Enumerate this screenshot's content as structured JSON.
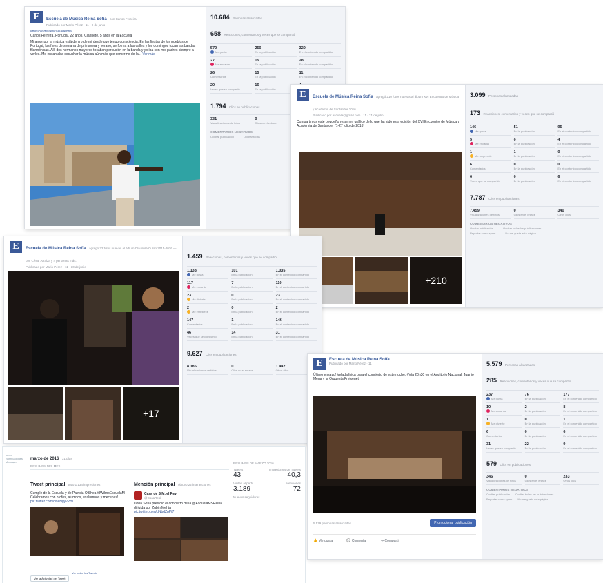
{
  "page_name": "Escuela de Música Reina Sofía",
  "logo_letter": "E",
  "card1": {
    "author_suffix": "con Carlos Ferreira",
    "meta": "Publicado por Mario Pérez · 11 · 9 de junio",
    "hashtag": "#misicosdelaescueladeofia",
    "text": "Carlos Ferreira. Portugal, 22 años. Clarinete. 5 años en la Escuela",
    "body": "Mi amor por la música está dentro de mí desde que tengo consciencia. En las fiestas de los pueblos de Portugal, los fines de semana de primavera y verano, se forma a las calles y los domingos tocan las bandas filarmónicas. Allí dos hermanos mayores tocaban percusión en la banda y yo iba con mis padres siempre a verles. Me encantaba escuchar la música aún más que comerme de la...",
    "see_more": "Ver más",
    "reach_top": "10.684",
    "reach_top_label": "Personas alcanzadas",
    "reactions": "658",
    "reactions_label": "Reacciones, comentarios y veces que se compartió",
    "rows": [
      [
        "570",
        "Me gusta",
        "250",
        "En la publicación",
        "320",
        "En el contenido compartido"
      ],
      [
        "27",
        "Me encanta",
        "15",
        "En la publicación",
        "28",
        "En el contenido compartido"
      ],
      [
        "26",
        "Comentarios",
        "15",
        "En la publicación",
        "11",
        "En el contenido compartido"
      ],
      [
        "20",
        "Veces que se compartió",
        "16",
        "En la publicación",
        "4",
        "En el contenido compartido"
      ]
    ],
    "clicks": "1.794",
    "clicks_label": "Clics en publicaciones",
    "sub": [
      "331",
      "Visualizaciones de fotos",
      "0",
      "Clics en el enlace"
    ],
    "neg_title": "COMENTARIOS NEGATIVOS",
    "neg": [
      "Ocultar publicación",
      "0",
      "Ocultar todas",
      "0"
    ]
  },
  "card2": {
    "author_suffix": "agregó 210 fotos nuevas al álbum XVI Encuentro de Música y Academia de Santander 2016.",
    "meta": "Publicado por escuela@gmail.com · 11 · 21 de julio",
    "text": "Compartimos este pequeño resumen gráfico de lo que ha sido esta edición del XVI Encuentro de Música y Academia de Santander (1-27 julio de 2016)",
    "reach_top": "3.099",
    "reach_top_label": "Personas alcanzadas",
    "reactions": "173",
    "reactions_label": "Reacciones, comentarios y veces que se compartió",
    "rows": [
      [
        "146",
        "Me gusta",
        "51",
        "En la publicación",
        "95",
        "En el contenido compartido"
      ],
      [
        "5",
        "Me encanta",
        "0",
        "En la publicación",
        "4",
        "En el contenido compartido"
      ],
      [
        "1",
        "Me sorprende",
        "1",
        "En la publicación",
        "0",
        "En el contenido compartido"
      ],
      [
        "6",
        "Comentarios",
        "0",
        "En la publicación",
        "0",
        "En el contenido compartido"
      ],
      [
        "6",
        "Veces que se compartió",
        "0",
        "En la publicación",
        "6",
        "En el contenido compartido"
      ]
    ],
    "clicks": "7.787",
    "clicks_label": "Clics en publicaciones",
    "sub": [
      "7.459",
      "Visualizaciones de fotos",
      "0",
      "Clics en el enlace",
      "340",
      "Otros clics"
    ],
    "plus": "+210",
    "neg_title": "COMENTARIOS NEGATIVOS",
    "neg": [
      "Ocultar publicación",
      "Ocultar todas las publicaciones",
      "Reportar como spam",
      "No me gusta esta página"
    ]
  },
  "card3": {
    "author_suffix": "agregó 22 fotos nuevas al álbum Clausura Curso 2015-2016 — con César Arraiza y 4 personas más.",
    "meta": "Publicado por Mario Pérez · 11 · 30 de junio",
    "reactions": "1.459",
    "reactions_label": "Reacciones, comentarios y veces que se compartió",
    "rows": [
      [
        "1.138",
        "Me gusta",
        "101",
        "En la publicación",
        "1.035",
        "En el contenido compartido"
      ],
      [
        "117",
        "Me encanta",
        "7",
        "En la publicación",
        "110",
        "En el contenido compartido"
      ],
      [
        "23",
        "Me divierte",
        "0",
        "En la publicación",
        "23",
        "En el contenido compartido"
      ],
      [
        "2",
        "Me entristece",
        "0",
        "En la publicación",
        "2",
        "En el contenido compartido"
      ],
      [
        "147",
        "Comentarios",
        "1",
        "En la publicación",
        "146",
        "En el contenido compartido"
      ],
      [
        "46",
        "Veces que se compartió",
        "14",
        "En la publicación",
        "31",
        "En el contenido compartido"
      ]
    ],
    "clicks": "9.627",
    "clicks_label": "Clics en publicaciones",
    "sub": [
      "8.185",
      "Visualizaciones de fotos",
      "0",
      "Clics en el enlace",
      "1.442",
      "Otros clics"
    ],
    "plus": "+17"
  },
  "card4": {
    "author": "Escuela de Música Reina Sofía",
    "meta": "Publicado por Mario Pérez · 11",
    "text": "Último ensayo! Velada lírica para el concierto de este noche. #Vía 20h30 en el Auditorio Nacional, Juanjo Mena y la Orquesta Freixenet",
    "reach_top": "5.579",
    "reach_top_label": "Personas alcanzadas",
    "reactions": "285",
    "reactions_label": "Reacciones, comentarios y veces que se compartió",
    "rows": [
      [
        "237",
        "Me gusta",
        "76",
        "En la publicación",
        "177",
        "En el contenido compartido"
      ],
      [
        "10",
        "Me encanta",
        "2",
        "En la publicación",
        "8",
        "En el contenido compartido"
      ],
      [
        "1",
        "Me divierte",
        "0",
        "En la publicación",
        "1",
        "En el contenido compartido"
      ],
      [
        "6",
        "Comentarios",
        "0",
        "En la publicación",
        "6",
        "En el contenido compartido"
      ],
      [
        "31",
        "Veces que se compartió",
        "22",
        "En la publicación",
        "9",
        "En el contenido compartido"
      ]
    ],
    "clicks": "579",
    "clicks_label": "Clics en publicaciones",
    "sub": [
      "346",
      "Visualizaciones de fotos",
      "0",
      "Clics en el enlace",
      "233",
      "Otros clics"
    ],
    "people_reached": "5.579 personas alcanzadas",
    "boost": "Promocionar publicación",
    "actions": [
      "Me gusta",
      "Comentar",
      "Compartir"
    ],
    "neg_title": "COMENTARIOS NEGATIVOS",
    "neg": [
      "Ocultar publicación",
      "Ocultar todas las publicaciones",
      "Reportar como spam",
      "No me gusta esta página"
    ]
  },
  "card5": {
    "month": "marzo de 2016",
    "month_suffix": "31 días",
    "subhead": "RESUMEN DEL MES",
    "top_tweet_title": "Tweet principal",
    "top_tweet_sub": "tuvo 1.134 impresiones",
    "top_tweet_text": "Cumple de la Escuela y de Patricia O'Shea #IWilmoEscuelaM Celebramos con profes, alumnos, exalumnos y mecenas!",
    "top_tweet_link": "pic.twitter.com/dNeHgyvPml",
    "mention_title": "Mención principal",
    "mention_sub": "obtuvo 22 interacciones",
    "mention_author": "Casa de S.M. el Rey",
    "mention_handle": "@CasaReal",
    "mention_text": "Doña Sofía presidió el concierto de la @EscuelaMSReina dirigida por Zubin Mehta",
    "mention_link": "pic.twitter.com/dNbdZpPt7",
    "see_all": "Ver todos los Tweets",
    "activity_button": "Ver la Actividad del Tweet",
    "stats_title": "RESUMEN DE MARZO 2016",
    "tweets_label": "Tweets",
    "tweets": "43",
    "impr_label": "Impresiones de Tweets",
    "impr": "40,3",
    "visits_label": "Visitas al perfil",
    "visits": "3.189",
    "mentions_label": "Menciones",
    "mentions": "72",
    "followers_label": "Nuevos seguidores",
    "side_tabs": "Inicio  Notificaciones  Mensajes"
  }
}
